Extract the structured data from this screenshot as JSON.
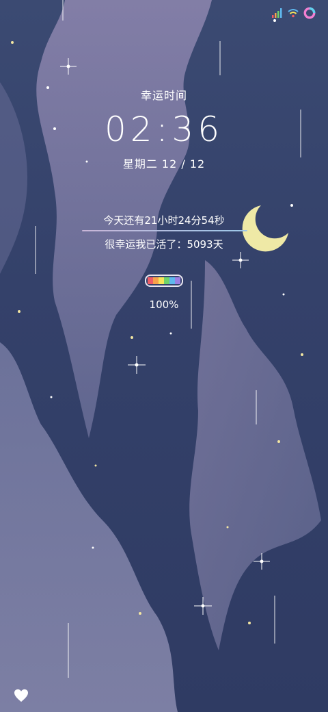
{
  "status_bar": {
    "icons": [
      "signal-icon",
      "wifi-icon",
      "ring-app-icon"
    ]
  },
  "lockscreen": {
    "title": "幸运时间",
    "time": "02:36",
    "date": "星期二   12 / 12",
    "countdown": "今天还有21小时24分54秒",
    "alive": "很幸运我已活了：5093天",
    "battery_percent": "100%",
    "battery_level": 1.0
  },
  "colors": {
    "sky": "#34416a",
    "cloud": "#8e86ad",
    "moon": "#efe9a6",
    "battery_stripes": [
      "#ef5d66",
      "#f7a24b",
      "#f6e45a",
      "#6fd36b",
      "#5fb8ef",
      "#9b7fe4"
    ]
  },
  "bottom": {
    "icon": "heart-icon"
  }
}
